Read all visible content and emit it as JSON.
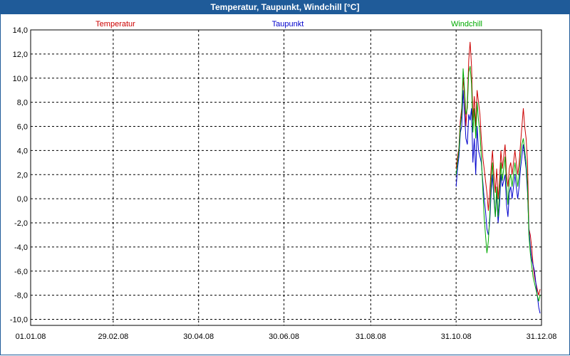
{
  "window": {
    "title": "Temperatur, Taupunkt, Windchill [°C]"
  },
  "chart_data": {
    "type": "line",
    "title": "Temperatur, Taupunkt, Windchill [°C]",
    "xlabel": "",
    "ylabel": "",
    "x_ticks": [
      "01.01.08",
      "29.02.08",
      "30.04.08",
      "30.06.08",
      "31.08.08",
      "31.10.08",
      "31.12.08"
    ],
    "xlim": [
      "2008-01-01",
      "2008-12-31"
    ],
    "ylim": [
      -10.5,
      14.0
    ],
    "y_ticks": [
      14,
      12,
      10,
      8,
      6,
      4,
      2,
      0,
      -2,
      -4,
      -6,
      -8,
      -10
    ],
    "y_tick_labels": [
      "14,0",
      "12,0",
      "10,0",
      "8,0",
      "6,0",
      "4,0",
      "2,0",
      "0,0",
      "-2,0",
      "-4,0",
      "-6,0",
      "-8,0",
      "-10,0"
    ],
    "grid": true,
    "legend_position": "top",
    "series": [
      {
        "name": "Temperatur",
        "color": "#cc0000",
        "points": [
          [
            "2008-10-31",
            2.5
          ],
          [
            "2008-11-01",
            3.5
          ],
          [
            "2008-11-02",
            4.2
          ],
          [
            "2008-11-03",
            6.5
          ],
          [
            "2008-11-04",
            7.5
          ],
          [
            "2008-11-05",
            10.0
          ],
          [
            "2008-11-06",
            8.5
          ],
          [
            "2008-11-07",
            6.0
          ],
          [
            "2008-11-08",
            8.0
          ],
          [
            "2008-11-09",
            11.5
          ],
          [
            "2008-11-10",
            13.0
          ],
          [
            "2008-11-11",
            11.0
          ],
          [
            "2008-11-12",
            6.5
          ],
          [
            "2008-11-13",
            8.5
          ],
          [
            "2008-11-14",
            6.0
          ],
          [
            "2008-11-15",
            9.0
          ],
          [
            "2008-11-16",
            8.0
          ],
          [
            "2008-11-17",
            7.0
          ],
          [
            "2008-11-18",
            5.0
          ],
          [
            "2008-11-19",
            3.5
          ],
          [
            "2008-11-20",
            2.5
          ],
          [
            "2008-11-21",
            1.5
          ],
          [
            "2008-11-22",
            0.5
          ],
          [
            "2008-11-23",
            -1.0
          ],
          [
            "2008-11-24",
            0.5
          ],
          [
            "2008-11-25",
            2.5
          ],
          [
            "2008-11-26",
            4.0
          ],
          [
            "2008-11-27",
            2.0
          ],
          [
            "2008-11-28",
            0.5
          ],
          [
            "2008-11-29",
            2.5
          ],
          [
            "2008-11-30",
            0.0
          ],
          [
            "2008-12-01",
            1.5
          ],
          [
            "2008-12-02",
            4.0
          ],
          [
            "2008-12-03",
            2.5
          ],
          [
            "2008-12-04",
            3.5
          ],
          [
            "2008-12-05",
            4.5
          ],
          [
            "2008-12-06",
            2.0
          ],
          [
            "2008-12-07",
            1.0
          ],
          [
            "2008-12-08",
            2.5
          ],
          [
            "2008-12-09",
            3.0
          ],
          [
            "2008-12-10",
            2.0
          ],
          [
            "2008-12-11",
            3.0
          ],
          [
            "2008-12-12",
            4.0
          ],
          [
            "2008-12-13",
            3.0
          ],
          [
            "2008-12-14",
            2.0
          ],
          [
            "2008-12-15",
            3.0
          ],
          [
            "2008-12-16",
            4.5
          ],
          [
            "2008-12-17",
            6.0
          ],
          [
            "2008-12-18",
            7.5
          ],
          [
            "2008-12-19",
            6.0
          ],
          [
            "2008-12-20",
            5.0
          ],
          [
            "2008-12-21",
            3.0
          ],
          [
            "2008-12-22",
            -2.5
          ],
          [
            "2008-12-23",
            -3.0
          ],
          [
            "2008-12-24",
            -4.0
          ],
          [
            "2008-12-25",
            -5.5
          ],
          [
            "2008-12-26",
            -6.5
          ],
          [
            "2008-12-27",
            -7.0
          ],
          [
            "2008-12-28",
            -7.5
          ],
          [
            "2008-12-29",
            -8.0
          ],
          [
            "2008-12-30",
            -7.5
          ]
        ]
      },
      {
        "name": "Taupunkt",
        "color": "#0000cc",
        "points": [
          [
            "2008-10-31",
            1.0
          ],
          [
            "2008-11-01",
            2.5
          ],
          [
            "2008-11-02",
            3.5
          ],
          [
            "2008-11-03",
            5.5
          ],
          [
            "2008-11-04",
            6.0
          ],
          [
            "2008-11-05",
            9.0
          ],
          [
            "2008-11-06",
            7.0
          ],
          [
            "2008-11-07",
            5.0
          ],
          [
            "2008-11-08",
            4.5
          ],
          [
            "2008-11-09",
            7.0
          ],
          [
            "2008-11-10",
            6.5
          ],
          [
            "2008-11-11",
            7.5
          ],
          [
            "2008-11-12",
            3.0
          ],
          [
            "2008-11-13",
            5.0
          ],
          [
            "2008-11-14",
            2.0
          ],
          [
            "2008-11-15",
            6.0
          ],
          [
            "2008-11-16",
            4.0
          ],
          [
            "2008-11-17",
            3.5
          ],
          [
            "2008-11-18",
            3.0
          ],
          [
            "2008-11-19",
            1.5
          ],
          [
            "2008-11-20",
            0.0
          ],
          [
            "2008-11-21",
            -1.0
          ],
          [
            "2008-11-22",
            -2.5
          ],
          [
            "2008-11-23",
            -3.0
          ],
          [
            "2008-11-24",
            -2.0
          ],
          [
            "2008-11-25",
            0.5
          ],
          [
            "2008-11-26",
            2.0
          ],
          [
            "2008-11-27",
            0.0
          ],
          [
            "2008-11-28",
            -1.5
          ],
          [
            "2008-11-29",
            0.5
          ],
          [
            "2008-11-30",
            -2.0
          ],
          [
            "2008-12-01",
            -0.5
          ],
          [
            "2008-12-02",
            2.0
          ],
          [
            "2008-12-03",
            1.0
          ],
          [
            "2008-12-04",
            1.5
          ],
          [
            "2008-12-05",
            2.0
          ],
          [
            "2008-12-06",
            -0.5
          ],
          [
            "2008-12-07",
            -1.5
          ],
          [
            "2008-12-08",
            0.5
          ],
          [
            "2008-12-09",
            1.0
          ],
          [
            "2008-12-10",
            0.0
          ],
          [
            "2008-12-11",
            1.0
          ],
          [
            "2008-12-12",
            2.0
          ],
          [
            "2008-12-13",
            1.0
          ],
          [
            "2008-12-14",
            0.0
          ],
          [
            "2008-12-15",
            1.0
          ],
          [
            "2008-12-16",
            2.5
          ],
          [
            "2008-12-17",
            3.5
          ],
          [
            "2008-12-18",
            4.5
          ],
          [
            "2008-12-19",
            3.5
          ],
          [
            "2008-12-20",
            2.5
          ],
          [
            "2008-12-21",
            0.5
          ],
          [
            "2008-12-22",
            -2.5
          ],
          [
            "2008-12-23",
            -4.0
          ],
          [
            "2008-12-24",
            -5.0
          ],
          [
            "2008-12-25",
            -5.5
          ],
          [
            "2008-12-26",
            -6.0
          ],
          [
            "2008-12-27",
            -7.0
          ],
          [
            "2008-12-28",
            -8.0
          ],
          [
            "2008-12-29",
            -9.0
          ],
          [
            "2008-12-30",
            -9.5
          ]
        ]
      },
      {
        "name": "Windchill",
        "color": "#00aa00",
        "points": [
          [
            "2008-10-31",
            2.0
          ],
          [
            "2008-11-01",
            3.0
          ],
          [
            "2008-11-02",
            4.0
          ],
          [
            "2008-11-03",
            6.0
          ],
          [
            "2008-11-04",
            7.0
          ],
          [
            "2008-11-05",
            10.8
          ],
          [
            "2008-11-06",
            9.0
          ],
          [
            "2008-11-07",
            7.0
          ],
          [
            "2008-11-08",
            7.5
          ],
          [
            "2008-11-09",
            10.5
          ],
          [
            "2008-11-10",
            11.0
          ],
          [
            "2008-11-11",
            9.5
          ],
          [
            "2008-11-12",
            5.5
          ],
          [
            "2008-11-13",
            7.5
          ],
          [
            "2008-11-14",
            5.0
          ],
          [
            "2008-11-15",
            8.0
          ],
          [
            "2008-11-16",
            6.5
          ],
          [
            "2008-11-17",
            5.5
          ],
          [
            "2008-11-18",
            3.5
          ],
          [
            "2008-11-19",
            1.0
          ],
          [
            "2008-11-20",
            -1.5
          ],
          [
            "2008-11-21",
            -3.0
          ],
          [
            "2008-11-22",
            -4.5
          ],
          [
            "2008-11-23",
            -3.5
          ],
          [
            "2008-11-24",
            -1.5
          ],
          [
            "2008-11-25",
            1.5
          ],
          [
            "2008-11-26",
            3.0
          ],
          [
            "2008-11-27",
            0.5
          ],
          [
            "2008-11-28",
            -1.5
          ],
          [
            "2008-11-29",
            1.0
          ],
          [
            "2008-11-30",
            -1.5
          ],
          [
            "2008-12-01",
            0.5
          ],
          [
            "2008-12-02",
            3.0
          ],
          [
            "2008-12-03",
            1.5
          ],
          [
            "2008-12-04",
            2.5
          ],
          [
            "2008-12-05",
            3.5
          ],
          [
            "2008-12-06",
            1.0
          ],
          [
            "2008-12-07",
            -0.5
          ],
          [
            "2008-12-08",
            1.5
          ],
          [
            "2008-12-09",
            2.0
          ],
          [
            "2008-12-10",
            1.0
          ],
          [
            "2008-12-11",
            2.0
          ],
          [
            "2008-12-12",
            3.0
          ],
          [
            "2008-12-13",
            2.0
          ],
          [
            "2008-12-14",
            1.0
          ],
          [
            "2008-12-15",
            2.0
          ],
          [
            "2008-12-16",
            3.5
          ],
          [
            "2008-12-17",
            4.5
          ],
          [
            "2008-12-18",
            5.0
          ],
          [
            "2008-12-19",
            4.0
          ],
          [
            "2008-12-20",
            3.0
          ],
          [
            "2008-12-21",
            1.0
          ],
          [
            "2008-12-22",
            -3.0
          ],
          [
            "2008-12-23",
            -4.5
          ],
          [
            "2008-12-24",
            -5.5
          ],
          [
            "2008-12-25",
            -6.5
          ],
          [
            "2008-12-26",
            -7.0
          ],
          [
            "2008-12-27",
            -7.5
          ],
          [
            "2008-12-28",
            -8.0
          ],
          [
            "2008-12-29",
            -8.5
          ],
          [
            "2008-12-30",
            -8.0
          ]
        ]
      }
    ]
  }
}
